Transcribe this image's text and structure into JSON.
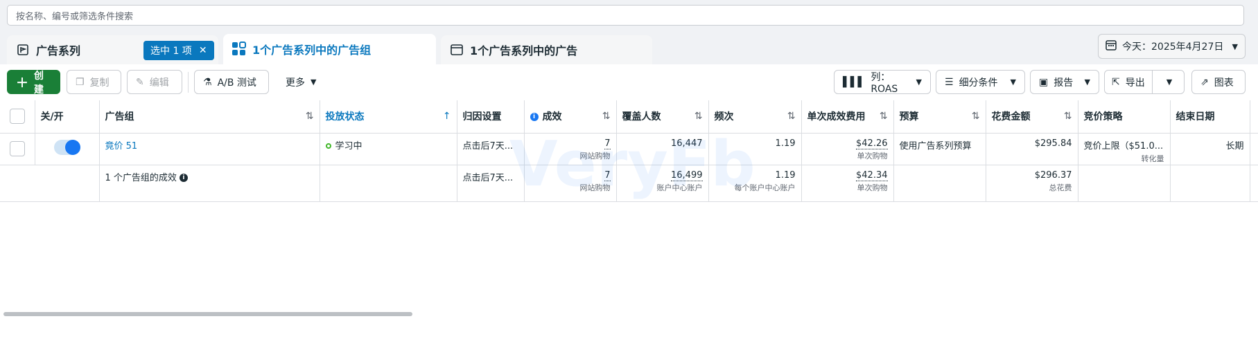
{
  "search": {
    "placeholder": "按名称、编号或筛选条件搜索"
  },
  "tabs": {
    "campaigns": "广告系列",
    "selected_badge": "选中 1 项",
    "adsets": "1个广告系列中的广告组",
    "ads": "1个广告系列中的广告"
  },
  "date": {
    "label": "今天：2025年4月27日"
  },
  "toolbar": {
    "create": "创建",
    "copy": "复制",
    "edit": "编辑",
    "ab_test": "A/B 测试",
    "more": "更多",
    "columns": "列：ROAS",
    "breakdown": "细分条件",
    "reports": "报告",
    "export": "导出",
    "charts": "图表"
  },
  "table": {
    "headers": {
      "onoff": "关/开",
      "adset": "广告组",
      "delivery": "投放状态",
      "attribution": "归因设置",
      "results": "成效",
      "reach": "覆盖人数",
      "frequency": "频次",
      "cost_per_result": "单次成效费用",
      "budget": "预算",
      "amount_spent": "花费金额",
      "bid_strategy": "竞价策略",
      "end_date": "结束日期"
    },
    "row": {
      "name": "竟价 51",
      "delivery": "学习中",
      "attribution": "点击后7天...",
      "results": "7",
      "results_sub": "网站购物",
      "reach": "16,447",
      "frequency": "1.19",
      "cost_per_result": "$42.26",
      "cost_sub": "单次购物",
      "budget": "使用广告系列预算",
      "amount_spent": "$295.84",
      "bid_strategy": "竞价上限（$51.0...",
      "bid_sub": "转化量",
      "end_date": "长期"
    },
    "summary": {
      "label": "1 个广告组的成效",
      "attribution": "点击后7天...",
      "results": "7",
      "results_sub": "网站购物",
      "reach": "16,499",
      "reach_sub": "账户中心账户",
      "frequency": "1.19",
      "frequency_sub": "每个账户中心账户",
      "cost_per_result": "$42.34",
      "cost_sub": "单次购物",
      "amount_spent": "$296.37",
      "amount_sub": "总花费"
    }
  },
  "watermark": "VeryFb"
}
